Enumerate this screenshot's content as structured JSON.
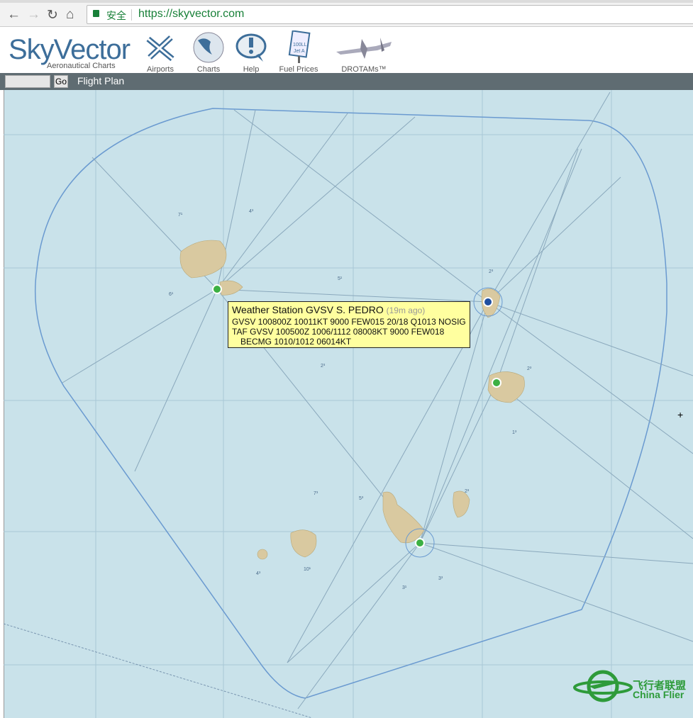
{
  "browser": {
    "secure_label": "安全",
    "url": "https://skyvector.com"
  },
  "header": {
    "logo": "SkyVector",
    "logo_sub": "Aeronautical Charts",
    "nav": [
      {
        "label": "Airports",
        "icon": "airport-icon"
      },
      {
        "label": "Charts",
        "icon": "globe-icon"
      },
      {
        "label": "Help",
        "icon": "help-bubble-icon"
      },
      {
        "label": "Fuel Prices",
        "icon": "fuel-sign-icon"
      },
      {
        "label": "DROTAMs™",
        "icon": "drone-icon"
      }
    ]
  },
  "toolbar": {
    "input_value": "",
    "go_label": "Go",
    "flight_plan_label": "Flight Plan"
  },
  "tooltip": {
    "title": "Weather Station GVSV S. PEDRO",
    "age": "(19m ago)",
    "metar": "GVSV 100800Z 10011KT 9000 FEW015 20/18 Q1013 NOSIG",
    "taf": "TAF GVSV 100500Z 1006/1112 08008KT 9000 FEW018",
    "taf_becmg": "BECMG 1010/1012 06014KT"
  },
  "map": {
    "mef_labels": [
      "7¹",
      "4³",
      "6¹",
      "5¹",
      "2³",
      "2³",
      "2³",
      "1³",
      "7³",
      "5³",
      "10¹",
      "4³",
      "3¹",
      "3³",
      "2³"
    ]
  },
  "watermark": {
    "cn": "飞行者联盟",
    "en": "China Flier"
  },
  "colors": {
    "sea": "#c9e2ea",
    "boundary": "#6a9ad0",
    "toolbar": "#5f6c72",
    "tooltip": "#ffff9f",
    "station_green": "#3cb043",
    "station_blue": "#1f4fa0"
  }
}
